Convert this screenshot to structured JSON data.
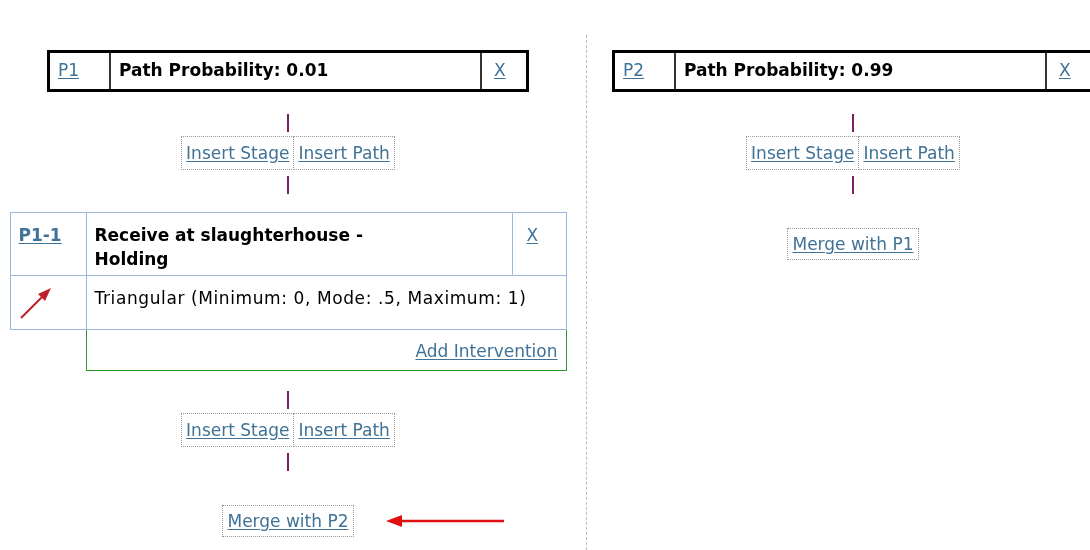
{
  "paths": [
    {
      "id": "P1",
      "probability": "Path Probability: 0.01",
      "close": "X",
      "blocks": [
        {
          "kind": "insert",
          "stage": "Insert Stage",
          "path": "Insert Path"
        },
        {
          "kind": "stage",
          "id": "P1-1",
          "name": "Receive at slaughterhouse - Holding",
          "close": "X",
          "distribution": "Triangular (Minimum: 0, Mode: .5, Maximum: 1)",
          "add_intervention": "Add Intervention"
        },
        {
          "kind": "insert",
          "stage": "Insert Stage",
          "path": "Insert Path"
        }
      ],
      "merge": {
        "label": "Merge with P2",
        "pointed": true
      }
    },
    {
      "id": "P2",
      "probability": "Path Probability: 0.99",
      "close": "X",
      "blocks": [
        {
          "kind": "insert",
          "stage": "Insert Stage",
          "path": "Insert Path"
        }
      ],
      "merge": {
        "label": "Merge with P1",
        "pointed": false
      }
    }
  ]
}
